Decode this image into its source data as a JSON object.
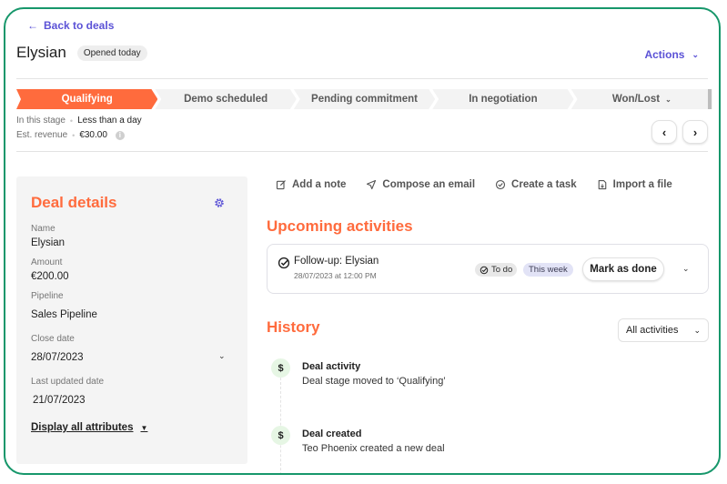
{
  "header": {
    "back_label": "Back to deals",
    "title": "Elysian",
    "status_badge": "Opened today",
    "actions_label": "Actions"
  },
  "pipeline": {
    "stages": [
      {
        "label": "Qualifying",
        "active": true
      },
      {
        "label": "Demo scheduled",
        "active": false
      },
      {
        "label": "Pending commitment",
        "active": false
      },
      {
        "label": "In negotiation",
        "active": false
      },
      {
        "label": "Won/Lost",
        "active": false
      }
    ],
    "in_stage_label": "In this stage",
    "in_stage_value": "Less than a day",
    "revenue_label": "Est. revenue",
    "revenue_value": "€30.00"
  },
  "deal_details": {
    "title": "Deal details",
    "fields": [
      {
        "label": "Name",
        "value": "Elysian"
      },
      {
        "label": "Amount",
        "value": "€200.00"
      },
      {
        "label": "Pipeline",
        "value": "Sales Pipeline"
      },
      {
        "label": "Close date",
        "value": "28/07/2023"
      },
      {
        "label": "Last updated date",
        "value": "21/07/2023"
      }
    ],
    "display_all_label": "Display all attributes"
  },
  "quick_actions": [
    {
      "label": "Add a note",
      "icon": "edit-note-icon"
    },
    {
      "label": "Compose an email",
      "icon": "send-icon"
    },
    {
      "label": "Create a task",
      "icon": "check-circle-icon"
    },
    {
      "label": "Import a file",
      "icon": "file-import-icon"
    }
  ],
  "upcoming": {
    "title": "Upcoming activities",
    "activity": {
      "title": "Follow-up: Elysian",
      "date": "28/07/2023 at 12:00 PM",
      "status_badge": "To do",
      "when_badge": "This week",
      "mark_done_label": "Mark as done"
    }
  },
  "history": {
    "title": "History",
    "filter_value": "All activities",
    "items": [
      {
        "icon": "$",
        "title": "Deal activity",
        "description": "Deal stage moved to ‘Qualifying’"
      },
      {
        "icon": "$",
        "title": "Deal created",
        "description": "Teo Phoenix created a new deal"
      }
    ]
  },
  "colors": {
    "accent": "#ff6b3d",
    "link": "#5b52d6",
    "frame": "#17976b"
  }
}
